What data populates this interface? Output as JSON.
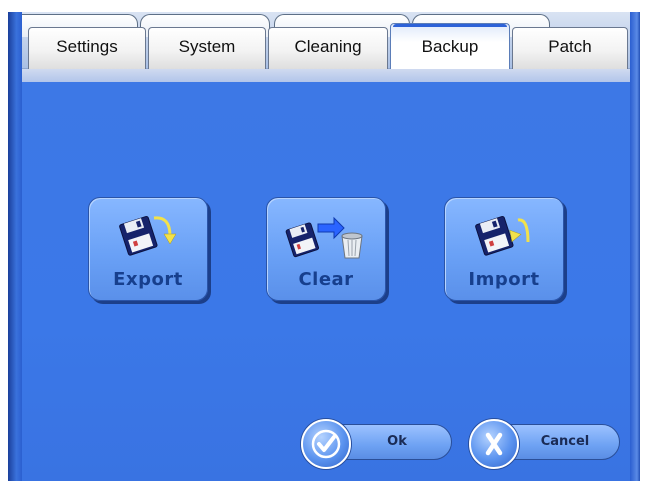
{
  "tabs": [
    {
      "label": "Settings",
      "active": false
    },
    {
      "label": "System",
      "active": false
    },
    {
      "label": "Cleaning",
      "active": false
    },
    {
      "label": "Backup",
      "active": true
    },
    {
      "label": "Patch",
      "active": false
    }
  ],
  "actions": {
    "export": {
      "label": "Export",
      "icon": "floppy-export-icon"
    },
    "clear": {
      "label": "Clear",
      "icon": "floppy-clear-trash-icon"
    },
    "import": {
      "label": "Import",
      "icon": "floppy-import-icon"
    }
  },
  "footer": {
    "ok": {
      "label": "Ok",
      "icon": "checkmark-icon"
    },
    "cancel": {
      "label": "Cancel",
      "icon": "x-mark-icon"
    }
  },
  "colors": {
    "panel": "#3b78e8",
    "button": "#6aa1f6",
    "label": "#173f8d",
    "arrow_yellow": "#f2e14a",
    "arrow_blue": "#2a64ff"
  }
}
